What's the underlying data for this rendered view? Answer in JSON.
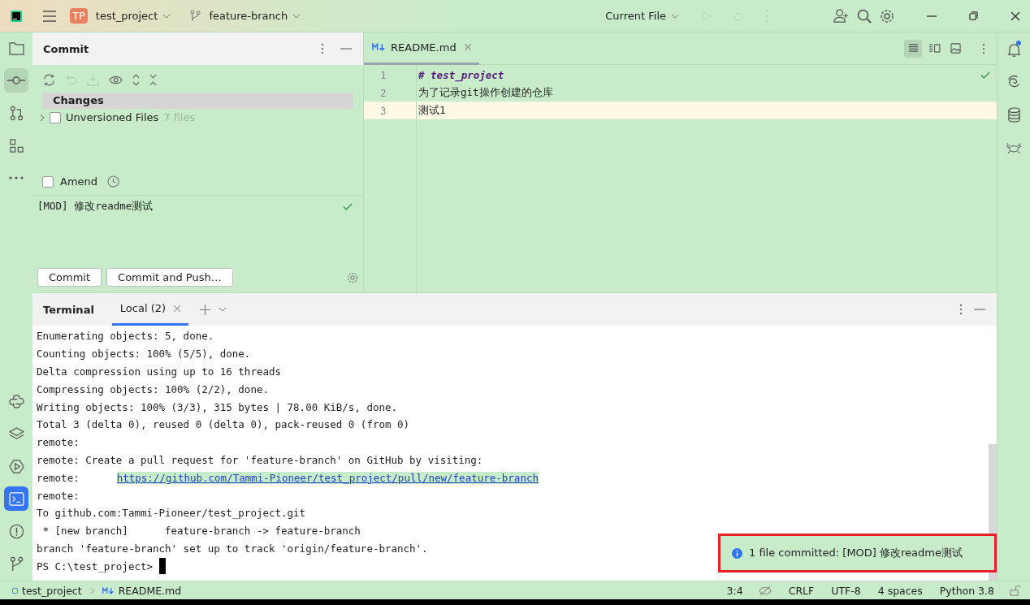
{
  "title_bar": {
    "project_initials": "TP",
    "project": "test_project",
    "branch": "feature-branch",
    "run_config": "Current File"
  },
  "left_toolbar_top": [
    {
      "kind": "folder",
      "selected": false
    },
    {
      "kind": "commit",
      "selected": true
    },
    {
      "kind": "pull-request",
      "selected": false
    },
    {
      "kind": "structure",
      "selected": false
    },
    {
      "kind": "more",
      "selected": false
    }
  ],
  "left_toolbar_bottom": [
    {
      "kind": "python",
      "selected": false
    },
    {
      "kind": "layers",
      "selected": false
    },
    {
      "kind": "run",
      "selected": false
    },
    {
      "kind": "terminal",
      "selected": true
    },
    {
      "kind": "problems",
      "selected": false
    },
    {
      "kind": "git",
      "selected": false
    }
  ],
  "right_toolbar": [
    {
      "kind": "bell",
      "badge": true
    },
    {
      "kind": "spiral"
    },
    {
      "kind": "database"
    },
    {
      "kind": "crab"
    }
  ],
  "commit_panel": {
    "title": "Commit",
    "changes_header": "Changes",
    "unversioned": {
      "label": "Unversioned Files",
      "count": "7 files",
      "checked": false,
      "expanded": false
    },
    "amend": {
      "label": "Amend",
      "checked": false
    },
    "message": "[MOD] 修改readme测试",
    "buttons": [
      "Commit",
      "Commit and Push…"
    ]
  },
  "editor": {
    "tab": "README.md",
    "lines": [
      {
        "number": "1",
        "text": "# test_project",
        "kind": "heading",
        "current": false
      },
      {
        "number": "2",
        "text": "为了记录git操作创建的仓库",
        "kind": "text",
        "current": false
      },
      {
        "number": "3",
        "text": "测试1",
        "kind": "text",
        "current": true
      }
    ]
  },
  "terminal": {
    "title": "Terminal",
    "tab": "Local (2)",
    "lines": [
      {
        "kind": "text",
        "text": "Enumerating objects: 5, done."
      },
      {
        "kind": "text",
        "text": "Counting objects: 100% (5/5), done."
      },
      {
        "kind": "text",
        "text": "Delta compression using up to 16 threads"
      },
      {
        "kind": "text",
        "text": "Compressing objects: 100% (2/2), done."
      },
      {
        "kind": "text",
        "text": "Writing objects: 100% (3/3), 315 bytes | 78.00 KiB/s, done."
      },
      {
        "kind": "text",
        "text": "Total 3 (delta 0), reused 0 (delta 0), pack-reused 0 (from 0)"
      },
      {
        "kind": "text",
        "text": "remote:"
      },
      {
        "kind": "text",
        "text": "remote: Create a pull request for 'feature-branch' on GitHub by visiting:"
      },
      {
        "kind": "link",
        "text": "remote:",
        "link": "https://github.com/Tammi-Pioneer/test_project/pull/new/feature-branch"
      },
      {
        "kind": "text",
        "text": "remote:"
      },
      {
        "kind": "text",
        "text": "To github.com:Tammi-Pioneer/test_project.git"
      },
      {
        "kind": "text",
        "text": " * [new branch]      feature-branch -> feature-branch"
      },
      {
        "kind": "text",
        "text": "branch 'feature-branch' set up to track 'origin/feature-branch'."
      },
      {
        "kind": "prompt",
        "text": "PS C:\\test_project>"
      }
    ]
  },
  "notification": {
    "text": "1 file committed: [MOD] 修改readme测试"
  },
  "status_bar": {
    "breadcrumbs": [
      "test_project",
      "README.md"
    ],
    "items": [
      "3:4",
      "CRLF",
      "UTF-8",
      "4 spaces",
      "Python 3.8"
    ]
  }
}
